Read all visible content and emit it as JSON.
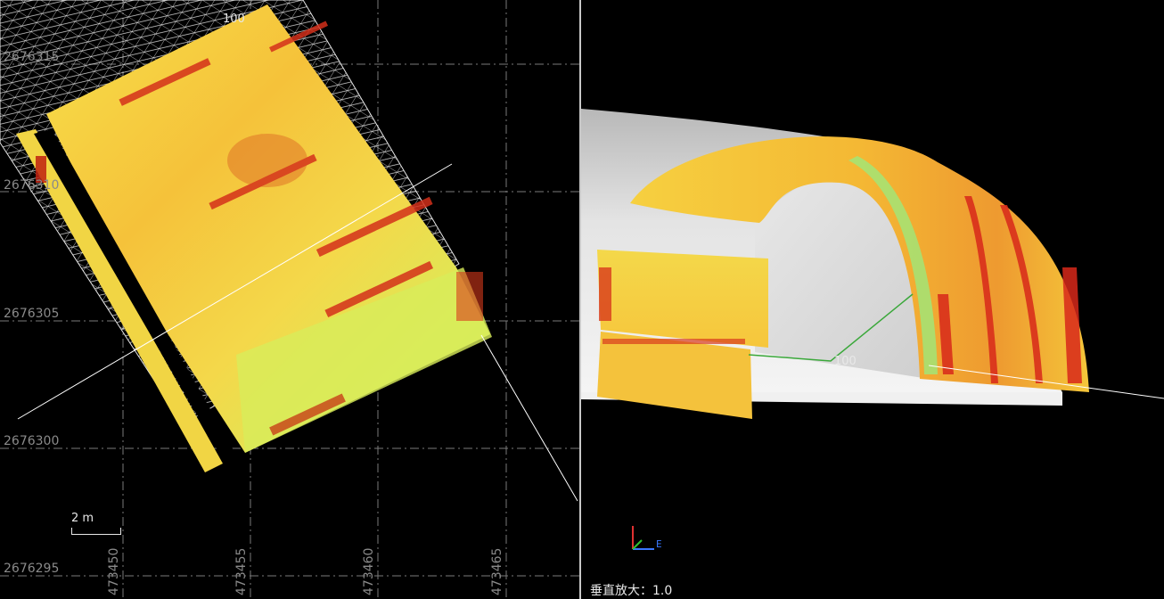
{
  "left_view": {
    "y_labels": [
      "2676315",
      "2676310",
      "2676305",
      "2676300",
      "2676295"
    ],
    "x_labels": [
      "473450",
      "473455",
      "473460",
      "473465"
    ],
    "scale_bar_label": "2 m",
    "station_marker": "100"
  },
  "right_view": {
    "station_marker": "100",
    "vertical_exaggeration_label": "垂直放大：",
    "vertical_exaggeration_value": "1.0",
    "axis_east_label": "E"
  },
  "colors": {
    "background": "#000000",
    "grid": "#7a7a7a",
    "label": "#8a8a8a",
    "scan_yellow": "#f6d63a",
    "scan_orange": "#f2a32e",
    "scan_red": "#d32a16",
    "scan_green": "#c8f05a",
    "tunnel_grey": "#d8d8d8"
  }
}
